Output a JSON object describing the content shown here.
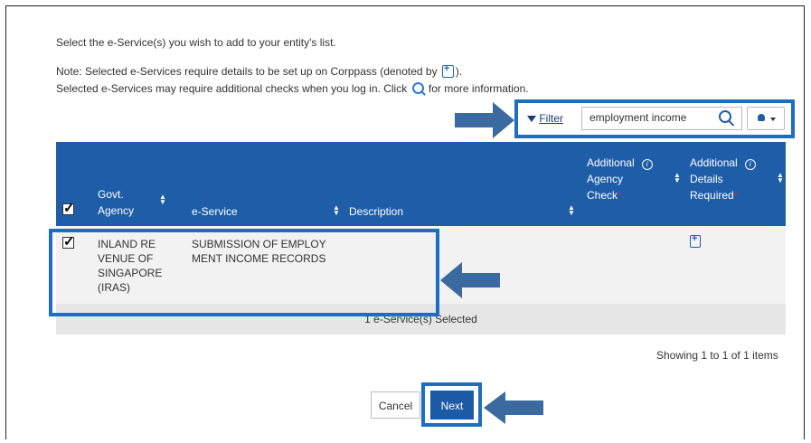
{
  "intro": "Select the e-Service(s) you wish to add to your entity's list.",
  "note_line1_pre": "Note: Selected e-Services require details to be set up on Corppass (denoted by",
  "note_line1_post": ").",
  "note_line2_pre": "Selected e-Services may require additional checks when you log in. Click",
  "note_line2_post": "for more information.",
  "filter_label": "Filter",
  "search_value": "employment income",
  "columns": {
    "agency_line1": "Govt.",
    "agency_line2": "Agency",
    "eservice": "e-Service",
    "description": "Description",
    "addl_check_line1": "Additional",
    "addl_check_line2": "Agency",
    "addl_check_line3": "Check",
    "addl_details_line1": "Additional",
    "addl_details_line2": "Details",
    "addl_details_line3": "Required"
  },
  "row": {
    "agency_lines": [
      "INLAND RE",
      "VENUE OF",
      "SINGAPORE",
      "(IRAS)"
    ],
    "eservice_lines": [
      "SUBMISSION OF EMPLOY",
      "MENT INCOME RECORDS"
    ]
  },
  "selected_count": "1 e-Service(s) Selected",
  "showing": "Showing 1 to 1 of 1 items",
  "buttons": {
    "cancel": "Cancel",
    "next": "Next"
  },
  "colors": {
    "header_bg": "#1e5ea8",
    "highlight": "#1c6fc0",
    "arrow": "#3b6aa0"
  }
}
